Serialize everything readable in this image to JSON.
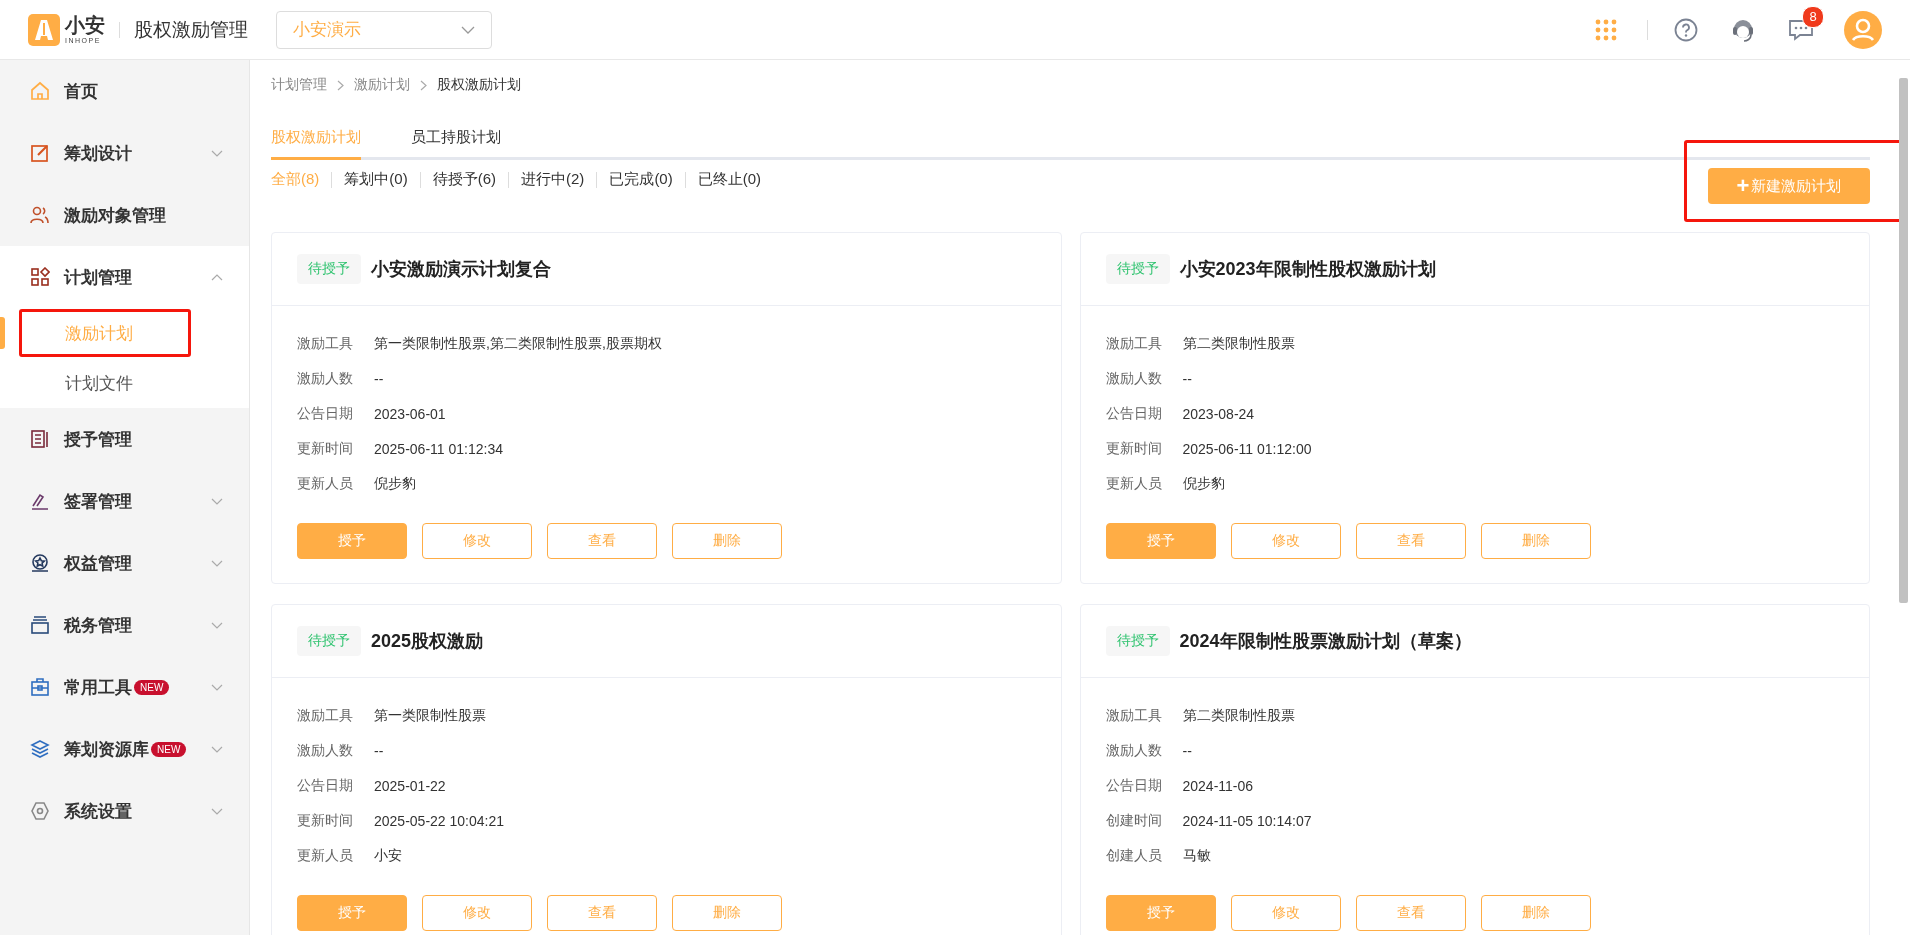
{
  "header": {
    "logo_text": "小安",
    "logo_subtext": "INHOPE",
    "app_title": "股权激励管理",
    "company_select": "小安演示",
    "message_count": "8"
  },
  "sidebar": {
    "items": [
      {
        "label": "首页",
        "selected": false
      },
      {
        "label": "筹划设计",
        "selected": false,
        "expanded": false
      },
      {
        "label": "激励对象管理",
        "selected": false
      },
      {
        "label": "计划管理",
        "selected": false,
        "expanded": true,
        "children": [
          {
            "label": "激励计划",
            "selected": true,
            "highlighted": true
          },
          {
            "label": "计划文件",
            "selected": false,
            "highlighted": false
          }
        ]
      },
      {
        "label": "授予管理",
        "selected": false
      },
      {
        "label": "签署管理",
        "selected": false,
        "expanded": false
      },
      {
        "label": "权益管理",
        "selected": false,
        "expanded": false
      },
      {
        "label": "税务管理",
        "selected": false,
        "expanded": false
      },
      {
        "label": "常用工具",
        "selected": false,
        "expanded": false,
        "badge": "NEW"
      },
      {
        "label": "筹划资源库",
        "selected": false,
        "expanded": false,
        "badge": "NEW"
      },
      {
        "label": "系统设置",
        "selected": false,
        "expanded": false
      }
    ]
  },
  "breadcrumb": [
    "计划管理",
    "激励计划",
    "股权激励计划"
  ],
  "tabs": [
    {
      "label": "股权激励计划",
      "selected": true
    },
    {
      "label": "员工持股计划",
      "selected": false
    }
  ],
  "filters": [
    {
      "label": "全部(8)",
      "selected": true
    },
    {
      "label": "筹划中(0)",
      "selected": false
    },
    {
      "label": "待授予(6)",
      "selected": false
    },
    {
      "label": "进行中(2)",
      "selected": false
    },
    {
      "label": "已完成(0)",
      "selected": false
    },
    {
      "label": "已终止(0)",
      "selected": false
    }
  ],
  "new_button": {
    "icon": "+",
    "label": "新建激励计划",
    "highlighted": true
  },
  "cards": [
    {
      "status": "待授予",
      "title": "小安激励演示计划复合",
      "fields": [
        {
          "label": "激励工具",
          "value": "第一类限制性股票,第二类限制性股票,股票期权"
        },
        {
          "label": "激励人数",
          "value": "--"
        },
        {
          "label": "公告日期",
          "value": "2023-06-01"
        },
        {
          "label": "更新时间",
          "value": "2025-06-11 01:12:34"
        },
        {
          "label": "更新人员",
          "value": "倪步豹"
        }
      ],
      "buttons": [
        {
          "label": "授予",
          "kind": "primary"
        },
        {
          "label": "修改",
          "kind": "outline"
        },
        {
          "label": "查看",
          "kind": "outline"
        },
        {
          "label": "删除",
          "kind": "outline"
        }
      ]
    },
    {
      "status": "待授予",
      "title": "小安2023年限制性股权激励计划",
      "fields": [
        {
          "label": "激励工具",
          "value": "第二类限制性股票"
        },
        {
          "label": "激励人数",
          "value": "--"
        },
        {
          "label": "公告日期",
          "value": "2023-08-24"
        },
        {
          "label": "更新时间",
          "value": "2025-06-11 01:12:00"
        },
        {
          "label": "更新人员",
          "value": "倪步豹"
        }
      ],
      "buttons": [
        {
          "label": "授予",
          "kind": "primary"
        },
        {
          "label": "修改",
          "kind": "outline"
        },
        {
          "label": "查看",
          "kind": "outline"
        },
        {
          "label": "删除",
          "kind": "outline"
        }
      ]
    },
    {
      "status": "待授予",
      "title": "2025股权激励",
      "fields": [
        {
          "label": "激励工具",
          "value": "第一类限制性股票"
        },
        {
          "label": "激励人数",
          "value": "--"
        },
        {
          "label": "公告日期",
          "value": "2025-01-22"
        },
        {
          "label": "更新时间",
          "value": "2025-05-22 10:04:21"
        },
        {
          "label": "更新人员",
          "value": "小安"
        }
      ],
      "buttons": [
        {
          "label": "授予",
          "kind": "primary"
        },
        {
          "label": "修改",
          "kind": "outline"
        },
        {
          "label": "查看",
          "kind": "outline"
        },
        {
          "label": "删除",
          "kind": "outline"
        }
      ]
    },
    {
      "status": "待授予",
      "title": "2024年限制性股票激励计划（草案）",
      "fields": [
        {
          "label": "激励工具",
          "value": "第二类限制性股票"
        },
        {
          "label": "激励人数",
          "value": "--"
        },
        {
          "label": "公告日期",
          "value": "2024-11-06"
        },
        {
          "label": "创建时间",
          "value": "2024-11-05 10:14:07"
        },
        {
          "label": "创建人员",
          "value": "马敏"
        }
      ],
      "buttons": [
        {
          "label": "授予",
          "kind": "primary"
        },
        {
          "label": "修改",
          "kind": "outline"
        },
        {
          "label": "查看",
          "kind": "outline"
        },
        {
          "label": "删除",
          "kind": "outline"
        }
      ]
    }
  ]
}
